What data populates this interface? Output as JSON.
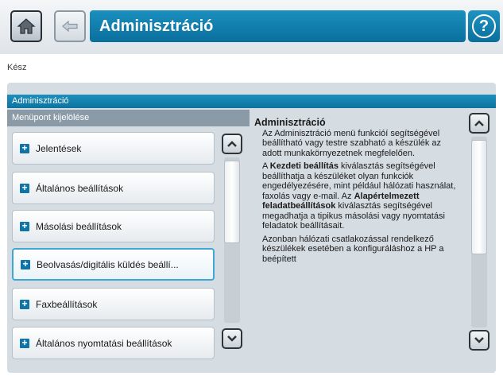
{
  "header": {
    "title": "Adminisztráció",
    "home_icon": "home-icon",
    "back_icon": "back-icon",
    "help_glyph": "?"
  },
  "status": {
    "text": "Kész"
  },
  "panel": {
    "title": "Adminisztráció",
    "menu_header": "Menüpont kijelölése",
    "menu_items": [
      {
        "label": "Jelentések"
      },
      {
        "label": "Általános beállítások"
      },
      {
        "label": "Másolási beállítások"
      },
      {
        "label": "Beolvasás/digitális küldés beállí..."
      },
      {
        "label": "Faxbeállítások"
      },
      {
        "label": "Általános nyomtatási beállítások"
      }
    ],
    "selected_index": 3
  },
  "description": {
    "title": "Adminisztráció",
    "p1": "Az Adminisztráció menü funkcióí segítségével beállítható vagy testre szabható a készülék az adott munkakörnyezetnek megfelelően.",
    "p2_a": "A ",
    "p2_b": "Kezdeti beállítás",
    "p2_c": " kiválasztás segítségével beállíthatja a készüléket olyan funkciók engedélyezésére, mint például hálózati használat, faxolás vagy e-mail. Az ",
    "p2_d": "Alapértelmezett feladatbeállítások",
    "p2_e": " kiválasztás segítségével megadhatja a tipikus másolási vagy nyomtatási feladatok beállításait.",
    "p3": "Azonban hálózati csatlakozással rendelkező készülékek esetében a konfiguráláshoz a HP a beépített"
  },
  "colors": {
    "accent_blue": "#0d739f",
    "panel_bg": "#d5dce2",
    "selected_border": "#3fa6d8"
  }
}
